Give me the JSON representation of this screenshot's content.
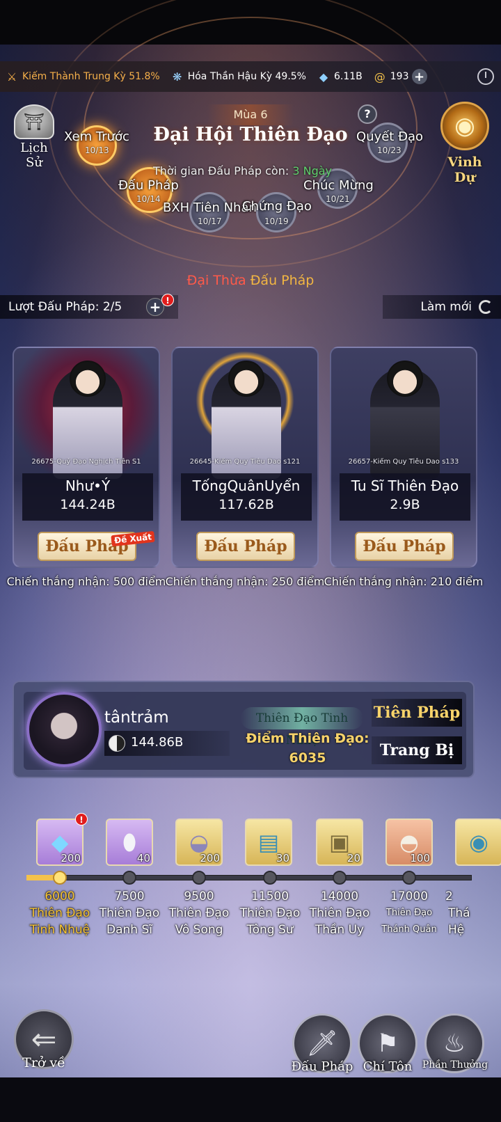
{
  "resources": [
    {
      "icon": "sword-icon",
      "text": "Kiếm Thành Trung Kỳ 51.8%"
    },
    {
      "icon": "fan-icon",
      "text": "Hóa Thần Hậu Kỳ 49.5%"
    },
    {
      "icon": "crystal-icon",
      "text": "6.11B"
    },
    {
      "icon": "coin-icon",
      "text": "193"
    }
  ],
  "header": {
    "history_label": "Lịch Sử",
    "season": "Mùa 6",
    "title": "Đại Hội Thiên Đạo",
    "help": "?",
    "honor_label": "Vinh Dự",
    "time_label": "Thời gian Đấu Pháp còn:",
    "time_value": "3 Ngày"
  },
  "schedule": [
    {
      "label": "Xem Trước",
      "date": "10/13"
    },
    {
      "label": "Đấu Pháp",
      "date": "10/14"
    },
    {
      "label": "BXH Tiên Nhân",
      "date": "10/17"
    },
    {
      "label": "Chứng Đạo",
      "date": "10/19"
    },
    {
      "label": "Chúc Mừng",
      "date": "10/21"
    },
    {
      "label": "Quyết Đạo",
      "date": "10/23"
    }
  ],
  "phase": {
    "part1": "Đại Thừa",
    "part2": "Đấu Pháp"
  },
  "turns": {
    "label": "Lượt Đấu Pháp: 2/5",
    "badge": "!",
    "refresh_label": "Làm mới"
  },
  "opponents": [
    {
      "server": "26675-Quỷ Đạo Nghịch Tiên S1",
      "name": "Như•Ý",
      "power": "144.24B",
      "button": "Đấu Pháp",
      "reward": "Chiến thắng nhận: 500 điểm"
    },
    {
      "server": "26645-Kiếm Quy Tiêu Dao s121",
      "name": "TốngQuânUyển",
      "power": "117.62B",
      "button": "Đấu Pháp",
      "reward": "Chiến thắng nhận: 250 điểm"
    },
    {
      "server": "26657-Kiếm Quy Tiêu Dao s133",
      "name": "Tu Sĩ Thiên Đạo",
      "power": "2.9B",
      "button": "Đấu Pháp",
      "reward": "Chiến thắng nhận: 210 điểm"
    }
  ],
  "suggest_tag": "Đề Xuất",
  "player": {
    "name": "tântrảm",
    "power": "144.86B",
    "rank": "Thiên Đạo Tinh Nhuệ",
    "points_label": "Điểm Thiên Đạo:",
    "points": "6035",
    "btn_skills": "Tiên Pháp",
    "btn_equipment": "Trang Bị"
  },
  "track": [
    {
      "qty": "200",
      "icon": "crystal-shard-icon",
      "value": "6000",
      "name": "Thiên Đạo Tinh Nhuệ"
    },
    {
      "qty": "40",
      "icon": "egg-icon",
      "value": "7500",
      "name": "Thiên Đạo Danh Sĩ"
    },
    {
      "qty": "200",
      "icon": "bowl-icon",
      "value": "9500",
      "name": "Thiên Đạo Vô Song"
    },
    {
      "qty": "30",
      "icon": "scroll-icon",
      "value": "11500",
      "name": "Thiên Đạo Tông Sư"
    },
    {
      "qty": "20",
      "icon": "chest-icon",
      "value": "14000",
      "name": "Thiên Đạo Thần Uy"
    },
    {
      "qty": "100",
      "icon": "dish-icon",
      "value": "17000",
      "name": "Thiên Đạo Thánh Quân"
    },
    {
      "qty": "",
      "icon": "item-icon",
      "value": "2",
      "name": "Thá Hệ"
    }
  ],
  "bottom": {
    "back": "Trở về",
    "nav": [
      "Đấu Pháp",
      "Chí Tôn",
      "Phần Thưởng"
    ]
  }
}
